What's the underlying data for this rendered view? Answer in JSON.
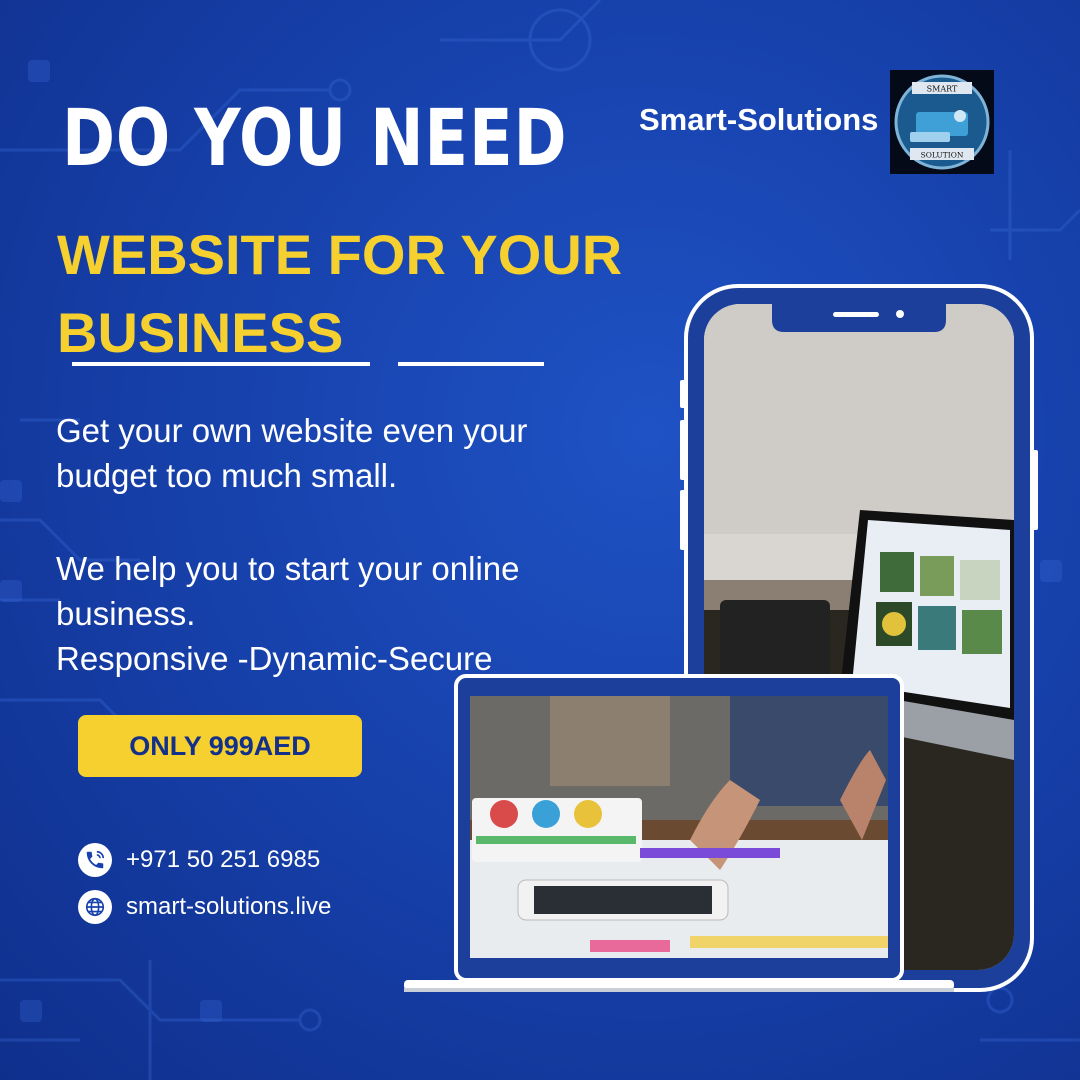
{
  "headline": {
    "line1": "DO YOU NEED",
    "line2": "WEBSITE FOR YOUR",
    "line3": "BUSINESS"
  },
  "body": {
    "paragraph1": "Get your own website even your budget too much small.",
    "paragraph2": "We help you to start your online business.",
    "features": "Responsive -Dynamic-Secure"
  },
  "cta": {
    "price_label": "ONLY 999AED"
  },
  "contact": {
    "phone": "+971 50 251 6985",
    "website": "smart-solutions.live",
    "phone_icon": "phone-icon",
    "web_icon": "globe-icon"
  },
  "brand": {
    "name": "Smart-Solutions",
    "logo_text_top": "SMART",
    "logo_text_bottom": "SOLUTION"
  },
  "colors": {
    "background": "#1742ad",
    "accent_yellow": "#f5d02e",
    "text_white": "#ffffff",
    "button_text": "#13308a"
  }
}
